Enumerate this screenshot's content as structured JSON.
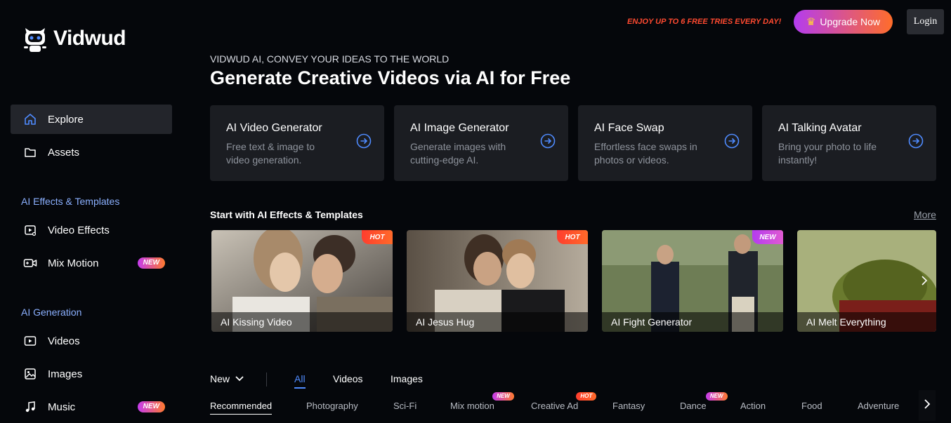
{
  "brand": {
    "name": "Vidwud"
  },
  "sidebar": {
    "explore": "Explore",
    "assets": "Assets",
    "section_effects": "AI Effects & Templates",
    "video_effects": "Video Effects",
    "mix_motion": "Mix Motion",
    "mix_motion_badge": "NEW",
    "section_generation": "AI Generation",
    "videos": "Videos",
    "images": "Images",
    "music": "Music",
    "music_badge": "NEW"
  },
  "topbar": {
    "promo": "ENJOY UP TO 6 FREE TRIES EVERY DAY!",
    "upgrade": "Upgrade Now",
    "login": "Login"
  },
  "hero": {
    "subtitle": "VIDWUD AI, CONVEY YOUR IDEAS TO THE WORLD",
    "title": "Generate Creative Videos via AI for Free"
  },
  "tools": [
    {
      "name": "AI Video Generator",
      "desc": "Free text & image to video generation."
    },
    {
      "name": "AI Image Generator",
      "desc": "Generate images with cutting-edge AI."
    },
    {
      "name": "AI Face Swap",
      "desc": "Effortless face swaps in photos or videos."
    },
    {
      "name": "AI Talking Avatar",
      "desc": "Bring your photo to life instantly!"
    }
  ],
  "templates_section": {
    "title": "Start with AI Effects & Templates",
    "more": "More"
  },
  "templates": [
    {
      "caption": "AI Kissing Video",
      "tag": "HOT"
    },
    {
      "caption": "AI Jesus Hug",
      "tag": "HOT"
    },
    {
      "caption": "AI Fight Generator",
      "tag": "NEW"
    },
    {
      "caption": "AI Melt Everything",
      "tag": ""
    }
  ],
  "filters": {
    "sort": "New",
    "types": [
      "All",
      "Videos",
      "Images"
    ],
    "categories": [
      {
        "label": "Recommended",
        "badge": ""
      },
      {
        "label": "Photography",
        "badge": ""
      },
      {
        "label": "Sci-Fi",
        "badge": ""
      },
      {
        "label": "Mix motion",
        "badge": "NEW"
      },
      {
        "label": "Creative Ad",
        "badge": "HOT"
      },
      {
        "label": "Fantasy",
        "badge": ""
      },
      {
        "label": "Dance",
        "badge": "NEW"
      },
      {
        "label": "Action",
        "badge": ""
      },
      {
        "label": "Food",
        "badge": ""
      },
      {
        "label": "Adventure",
        "badge": ""
      }
    ]
  },
  "colors": {
    "accent": "#4f8bff",
    "background": "#05070b",
    "card": "#1b1d22",
    "promo": "#ff4a30"
  }
}
